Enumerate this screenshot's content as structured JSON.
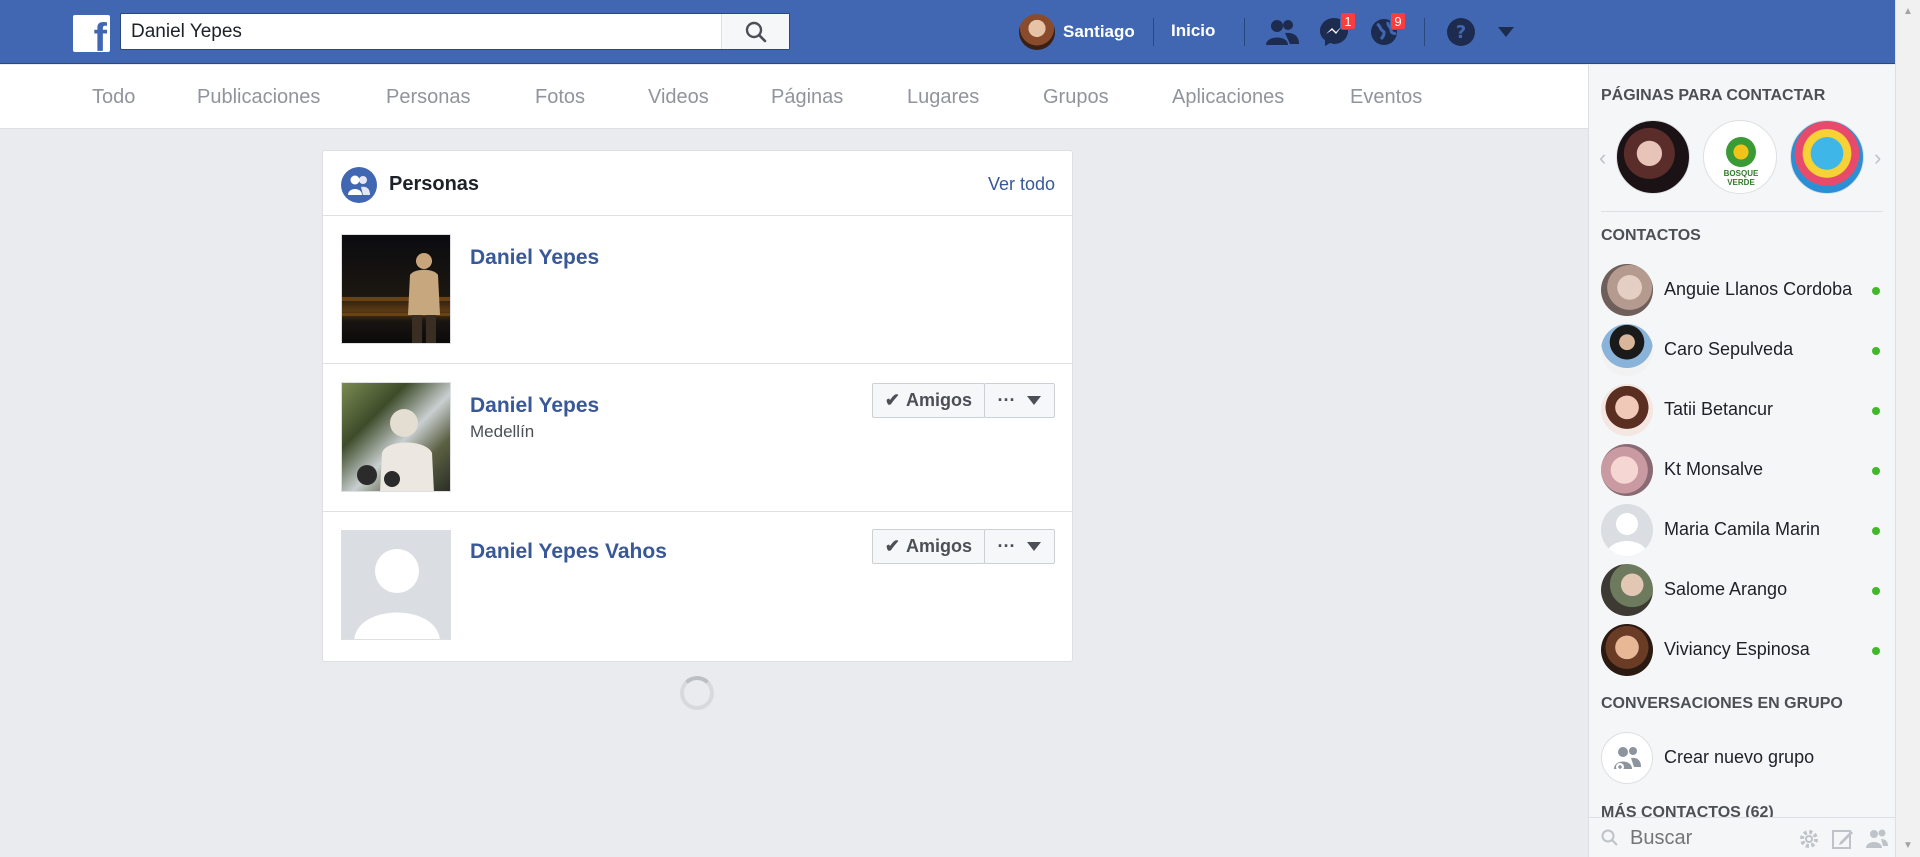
{
  "topbar": {
    "logo": "f",
    "search_value": "Daniel Yepes",
    "user_name": "Santiago",
    "home_label": "Inicio",
    "messages_badge": "1",
    "notifications_badge": "9",
    "accent_color": "#4267b2"
  },
  "filters": {
    "tabs": [
      "Todo",
      "Publicaciones",
      "Personas",
      "Fotos",
      "Videos",
      "Páginas",
      "Lugares",
      "Grupos",
      "Aplicaciones",
      "Eventos"
    ]
  },
  "results": {
    "section_title": "Personas",
    "see_all": "Ver todo",
    "items": [
      {
        "name": "Daniel Yepes",
        "subtitle": "",
        "friend_label": ""
      },
      {
        "name": "Daniel Yepes",
        "subtitle": "Medellín",
        "friend_label": "Amigos"
      },
      {
        "name": "Daniel Yepes Vahos",
        "subtitle": "",
        "friend_label": "Amigos"
      }
    ],
    "more_label": "···"
  },
  "sidebar": {
    "pages_heading": "PÁGINAS PARA CONTACTAR",
    "page_logo_text": "BOSQUE VERDE",
    "contacts_heading": "CONTACTOS",
    "contacts": [
      {
        "name": "Anguie Llanos Cordoba",
        "online": true
      },
      {
        "name": "Caro Sepulveda",
        "online": true
      },
      {
        "name": "Tatii Betancur",
        "online": true
      },
      {
        "name": "Kt Monsalve",
        "online": true
      },
      {
        "name": "Maria Camila Marin",
        "online": true
      },
      {
        "name": "Salome Arango",
        "online": true
      },
      {
        "name": "Viviancy Espinosa",
        "online": true
      }
    ],
    "group_heading": "CONVERSACIONES EN GRUPO",
    "create_group": "Crear nuevo grupo",
    "more_contacts": "MÁS CONTACTOS (62)",
    "search_placeholder": "Buscar",
    "online_color": "#42b72a"
  }
}
